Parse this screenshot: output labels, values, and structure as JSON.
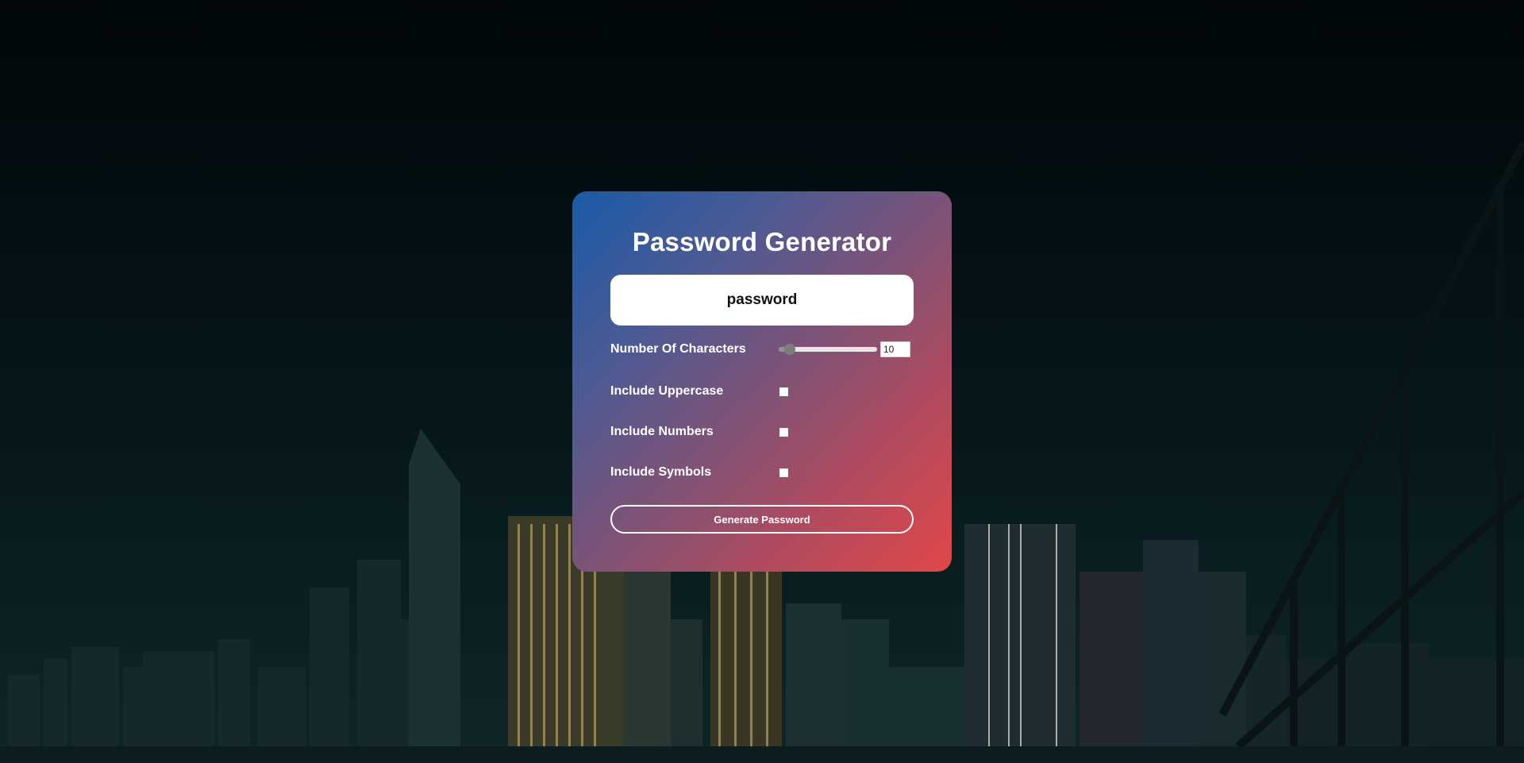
{
  "app": {
    "title": "Password Generator"
  },
  "password": {
    "value": "password"
  },
  "options": {
    "characters": {
      "label": "Number Of Characters",
      "value": "10",
      "min": 4,
      "max": 100,
      "current": 10
    },
    "uppercase": {
      "label": "Include Uppercase",
      "checked": false
    },
    "numbers": {
      "label": "Include Numbers",
      "checked": false
    },
    "symbols": {
      "label": "Include Symbols",
      "checked": false
    }
  },
  "actions": {
    "generate_label": "Generate Password"
  },
  "colors": {
    "card_gradient_start": "#1a5aa8",
    "card_gradient_end": "#e04848",
    "background": "#041216"
  }
}
